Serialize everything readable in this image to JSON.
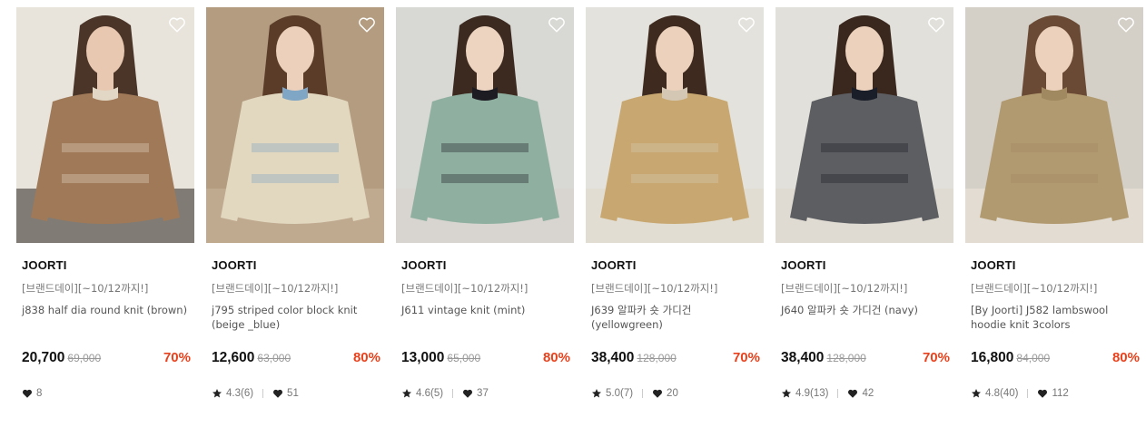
{
  "products": [
    {
      "brand": "JOORTI",
      "promo": "[브랜드데이][~10/12까지!]",
      "name": "j838 half dia round knit (brown)",
      "price": "20,700",
      "original_price": "69,000",
      "discount": "70%",
      "rating": "",
      "likes": "8",
      "colors": {
        "bg": "#e8e4dc",
        "garment": "#a07a58",
        "accent": "#e2d6c4",
        "hair": "#4a3528",
        "skin": "#e8c8b0",
        "pants": "#2a2420"
      }
    },
    {
      "brand": "JOORTI",
      "promo": "[브랜드데이][~10/12까지!]",
      "name": "j795 striped color block knit (beige _blue)",
      "price": "12,600",
      "original_price": "63,000",
      "discount": "80%",
      "rating": "4.3(6)",
      "likes": "51",
      "colors": {
        "bg": "#b49c80",
        "garment": "#e2d8c0",
        "accent": "#7fa6c4",
        "hair": "#5a3c28",
        "skin": "#ecd0bc",
        "pants": "#c8b49a"
      }
    },
    {
      "brand": "JOORTI",
      "promo": "[브랜드데이][~10/12까지!]",
      "name": "J611 vintage knit (mint)",
      "price": "13,000",
      "original_price": "65,000",
      "discount": "80%",
      "rating": "4.6(5)",
      "likes": "37",
      "colors": {
        "bg": "#d8d8d4",
        "garment": "#8fb0a0",
        "accent": "#1c1c22",
        "hair": "#3c2a20",
        "skin": "#ecd4c0",
        "pants": "#d8d4cc"
      }
    },
    {
      "brand": "JOORTI",
      "promo": "[브랜드데이][~10/12까지!]",
      "name": "J639 알파카 숏 가디건 (yellowgreen)",
      "price": "38,400",
      "original_price": "128,000",
      "discount": "70%",
      "rating": "5.0(7)",
      "likes": "20",
      "colors": {
        "bg": "#e4e2dc",
        "garment": "#c8a870",
        "accent": "#d4c8b4",
        "hair": "#3e2a1e",
        "skin": "#ecd2bc",
        "pants": "#e0d8cc"
      }
    },
    {
      "brand": "JOORTI",
      "promo": "[브랜드데이][~10/12까지!]",
      "name": "J640 알파카 숏 가디건 (navy)",
      "price": "38,400",
      "original_price": "128,000",
      "discount": "70%",
      "rating": "4.9(13)",
      "likes": "42",
      "colors": {
        "bg": "#e2e0da",
        "garment": "#5c5e62",
        "accent": "#1a1e28",
        "hair": "#3a281e",
        "skin": "#ecd2bc",
        "pants": "#dcd6cc"
      }
    },
    {
      "brand": "JOORTI",
      "promo": "[브랜드데이][~10/12까지!]",
      "name": "[By Joorti] J582 lambswool hoodie knit 3colors",
      "price": "16,800",
      "original_price": "84,000",
      "discount": "80%",
      "rating": "4.8(40)",
      "likes": "112",
      "colors": {
        "bg": "#d4d0c8",
        "garment": "#b29a70",
        "accent": "#a08860",
        "hair": "#6a4a34",
        "skin": "#ecd2bc",
        "pants": "#ece6dc"
      }
    }
  ]
}
